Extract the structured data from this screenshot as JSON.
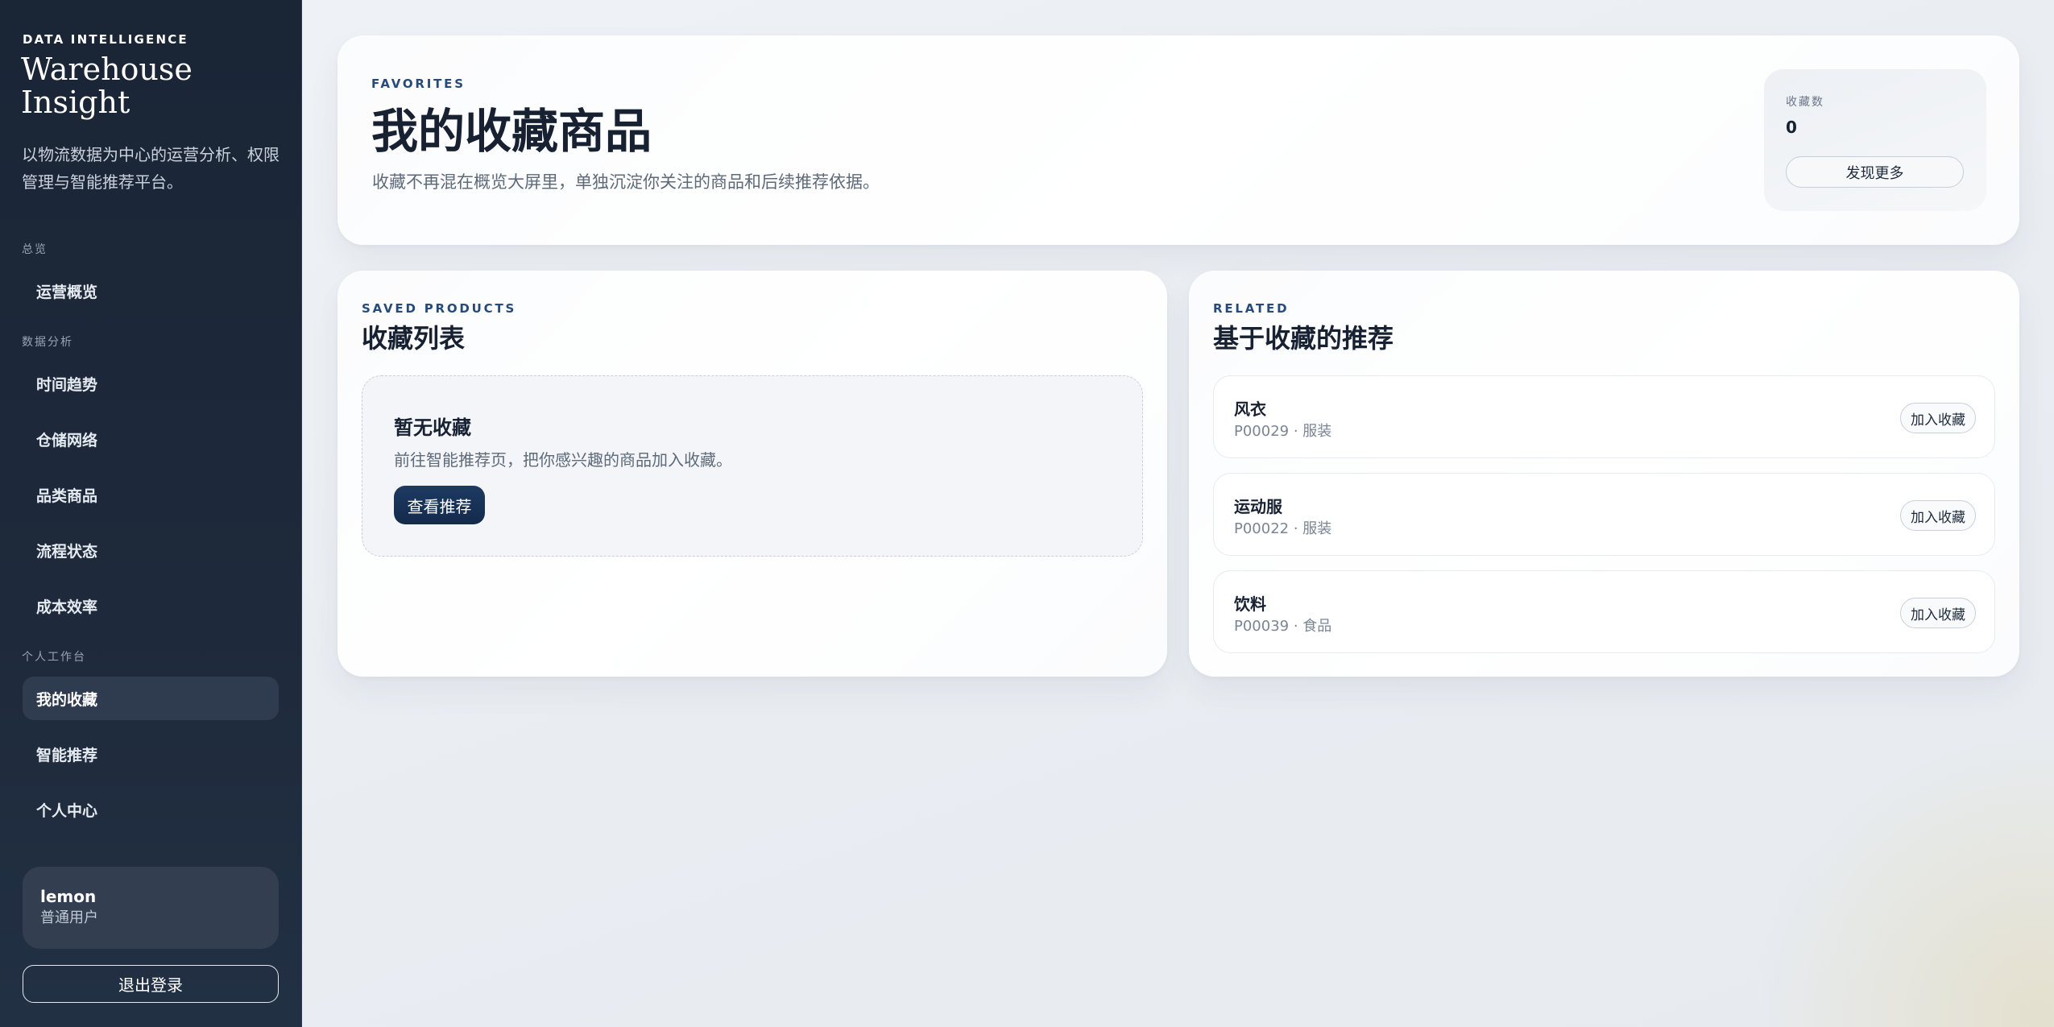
{
  "sidebar": {
    "eyebrow": "DATA INTELLIGENCE",
    "title": "Warehouse Insight",
    "description": "以物流数据为中心的运营分析、权限管理与智能推荐平台。",
    "groups": {
      "overview": "总览",
      "analysis": "数据分析",
      "workspace": "个人工作台"
    },
    "items": [
      {
        "label": "运营概览",
        "active": false
      },
      {
        "label": "时间趋势",
        "active": false
      },
      {
        "label": "仓储网络",
        "active": false
      },
      {
        "label": "品类商品",
        "active": false
      },
      {
        "label": "流程状态",
        "active": false
      },
      {
        "label": "成本效率",
        "active": false
      },
      {
        "label": "我的收藏",
        "active": true
      },
      {
        "label": "智能推荐",
        "active": false
      },
      {
        "label": "个人中心",
        "active": false
      }
    ],
    "user": {
      "name": "lemon",
      "role": "普通用户"
    },
    "logout_label": "退出登录"
  },
  "hero": {
    "eyebrow": "FAVORITES",
    "title": "我的收藏商品",
    "description": "收藏不再混在概览大屏里，单独沉淀你关注的商品和后续推荐依据。",
    "stat": {
      "label": "收藏数",
      "value": "0",
      "button_label": "发现更多"
    }
  },
  "saved": {
    "eyebrow": "SAVED PRODUCTS",
    "title": "收藏列表",
    "empty": {
      "title": "暂无收藏",
      "description": "前往智能推荐页，把你感兴趣的商品加入收藏。",
      "button_label": "查看推荐"
    }
  },
  "related": {
    "eyebrow": "RELATED",
    "title": "基于收藏的推荐",
    "items": [
      {
        "name": "风衣",
        "meta": "P00029 · 服装",
        "button_label": "加入收藏"
      },
      {
        "name": "运动服",
        "meta": "P00022 · 服装",
        "button_label": "加入收藏"
      },
      {
        "name": "饮料",
        "meta": "P00039 · 食品",
        "button_label": "加入收藏"
      }
    ]
  },
  "colors": {
    "sidebar_bg": "#1e2a3b",
    "accent": "#264a7a",
    "primary_button": "#1d3a63",
    "text_dark": "#172132"
  }
}
